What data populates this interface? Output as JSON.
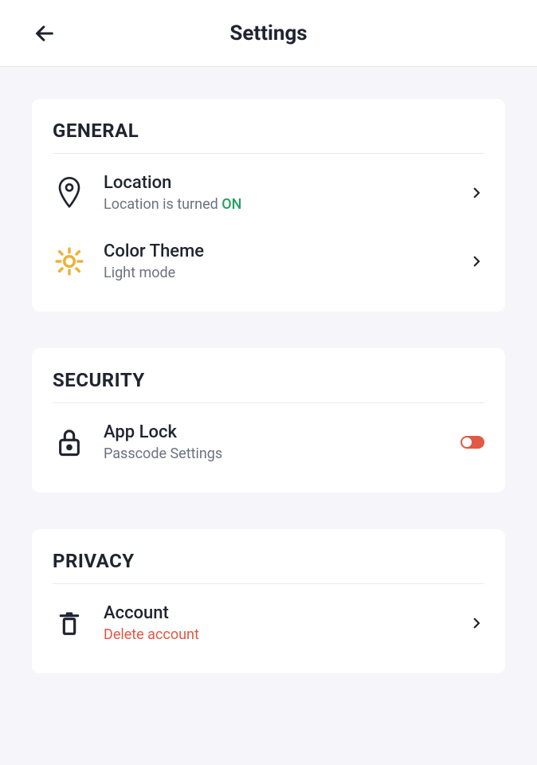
{
  "header": {
    "title": "Settings"
  },
  "sections": {
    "general": {
      "title": "GENERAL",
      "location": {
        "title": "Location",
        "sub_prefix": "Location is turned ",
        "sub_state": "ON"
      },
      "theme": {
        "title": "Color Theme",
        "sub": "Light mode"
      }
    },
    "security": {
      "title": "SECURITY",
      "applock": {
        "title": "App Lock",
        "sub": "Passcode Settings",
        "toggle": "on"
      }
    },
    "privacy": {
      "title": "PRIVACY",
      "account": {
        "title": "Account",
        "sub": "Delete account"
      }
    }
  },
  "colors": {
    "accent_danger": "#e15844",
    "accent_on": "#26a060",
    "sun": "#e9b338"
  }
}
